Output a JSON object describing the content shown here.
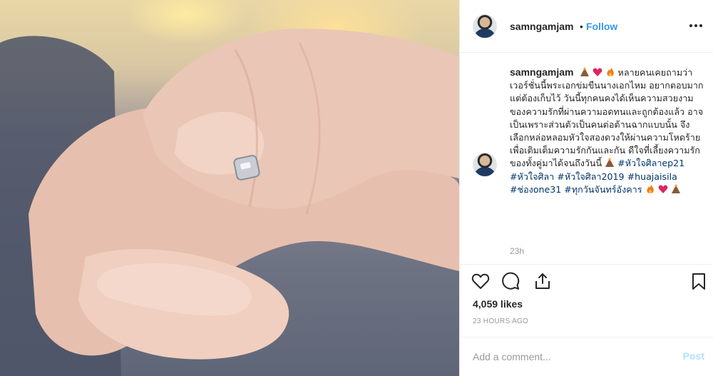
{
  "post": {
    "image_alt": "Close-up photo of hands holding, one wearing a silver ring"
  },
  "header": {
    "username": "samngamjam",
    "dot": "•",
    "follow_label": "Follow",
    "more_icon": "more-horizontal-icon"
  },
  "caption": {
    "username": "samngamjam",
    "text": "หลายคนเคยถามว่าเวอร์ชั่นนี้พระเอกข่มขืนนางเอกไหม อยากตอบมาก แต่ต้องเก็บไว้ วันนี้ทุกคนคงได้เห็นความสวยงามของความรักที่ผ่านความอดทนและถูกต้องแล้ว อาจเป็นเพราะส่วนตัวเป็นคนต่อต้านฉากแบบนั้น จึงเลือกหล่อหลอมหัวใจสองดวงให้ผ่านความโหดร้ายเพื่อเติมเต็มความรักกันและกัน ดีใจที่เลี้ยงความรักของทั้งคู่มาได้จนถึงวันนี้",
    "hashtags": [
      "#หัวใจศิลาep21",
      "#หัวใจศิลา",
      "#หัวใจศิลา2019",
      "#huajaisila",
      "#ช่องone31",
      "#ทุกวันจันทร์อังคาร"
    ],
    "time": "23h"
  },
  "actions": {
    "like_icon": "heart-icon",
    "comment_icon": "comment-icon",
    "share_icon": "share-icon",
    "save_icon": "bookmark-icon"
  },
  "likes": "4,059 likes",
  "timeago": "23 HOURS AGO",
  "comment": {
    "placeholder": "Add a comment...",
    "post_label": "Post"
  },
  "colors": {
    "accent": "#3897f0",
    "hashtag": "#003569",
    "muted": "#999999",
    "post_disabled": "#b2dffc"
  }
}
